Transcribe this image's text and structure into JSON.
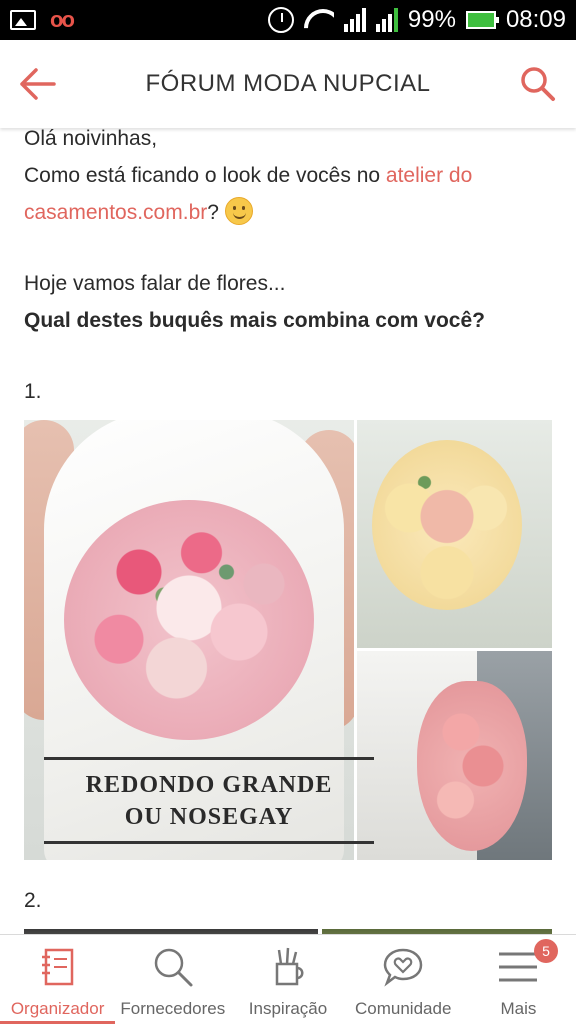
{
  "status_bar": {
    "battery": "99%",
    "time": "08:09",
    "signal1_label": "1",
    "signal2_label": "2"
  },
  "header": {
    "title": "FÓRUM MODA NUPCIAL",
    "back_icon": "back-arrow-icon",
    "search_icon": "search-icon"
  },
  "post": {
    "greeting": "Olá noivinhas,",
    "line2_prefix": "Como está ficando o look de vocês no ",
    "link_text_1": "atelier do",
    "link_text_2": "casamentos.com.br",
    "line2_suffix": "?",
    "line3": "Hoje vamos falar de flores...",
    "question": "Qual destes buquês mais combina com você?",
    "item1_number": "1.",
    "collage1_caption_1": "REDONDO GRANDE",
    "collage1_caption_2": "OU NOSEGAY",
    "item2_number": "2."
  },
  "bottom_nav": {
    "items": [
      {
        "label": "Organizador",
        "icon": "notebook-icon",
        "active": true
      },
      {
        "label": "Fornecedores",
        "icon": "search-icon"
      },
      {
        "label": "Inspiração",
        "icon": "pencil-cup-icon"
      },
      {
        "label": "Comunidade",
        "icon": "chat-heart-icon"
      },
      {
        "label": "Mais",
        "icon": "menu-icon",
        "badge": "5"
      }
    ]
  },
  "colors": {
    "accent": "#e0665e",
    "status_bar": "#000000",
    "text": "#2b2b2b"
  }
}
